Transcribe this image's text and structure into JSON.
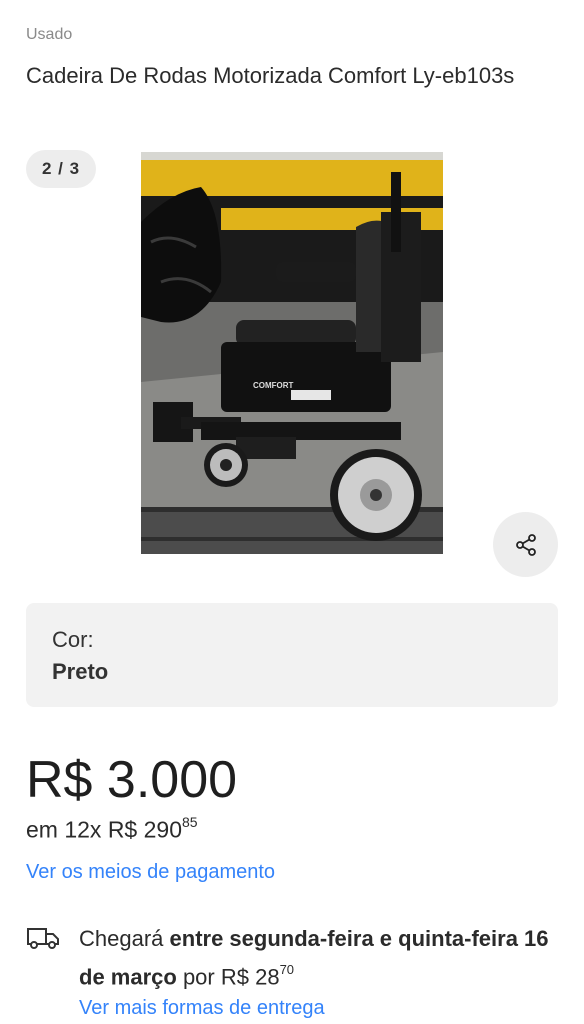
{
  "product": {
    "condition": "Usado",
    "title": "Cadeira De Rodas Motorizada Comfort Ly-eb103s",
    "image_counter": "2 / 3",
    "image_brand_text": "COMFORT"
  },
  "variant": {
    "label": "Cor:",
    "value": "Preto"
  },
  "pricing": {
    "price": "R$ 3.000",
    "installments_prefix": "em 12x R$ 290",
    "installments_cents": "85",
    "payment_link": "Ver os meios de pagamento"
  },
  "shipping": {
    "text_start": "Chegará ",
    "text_bold": "entre segunda-feira e quinta-feira 16 de março",
    "text_mid": " por R$ 28",
    "text_cents": "70",
    "more_link": "Ver mais formas de entrega"
  },
  "icons": {
    "share": "share-icon",
    "shipping": "truck-icon"
  },
  "colors": {
    "link": "#3483fa",
    "chip_bg": "#ededed",
    "box_bg": "#f2f2f2"
  }
}
